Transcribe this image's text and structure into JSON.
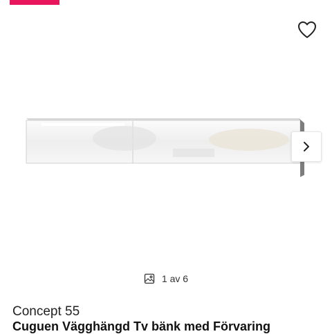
{
  "colors": {
    "accent": "#e8175d"
  },
  "product": {
    "brand": "Concept 55",
    "title": "Cuguen Vägghängd Tv bänk med Förvaring"
  },
  "gallery": {
    "counter": "1 av 6",
    "current": 1,
    "total": 6
  },
  "icons": {
    "wishlist": "heart-icon",
    "next": "chevron-right-icon",
    "gallery": "image-icon"
  }
}
